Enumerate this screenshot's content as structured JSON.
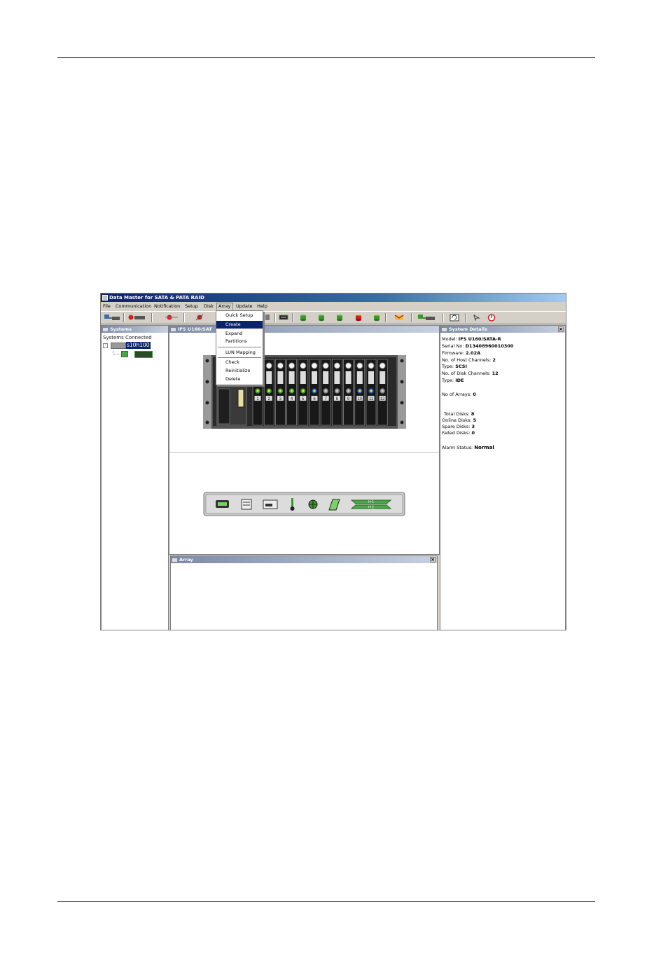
{
  "app": {
    "title": "Data Master for SATA & PATA RAID",
    "menu": [
      "File",
      "Communication",
      "Notification",
      "Setup",
      "Disk",
      "Array",
      "Update",
      "Help"
    ]
  },
  "array_menu": {
    "items": [
      "Quick Setup",
      "Create",
      "Expand",
      "Partitions",
      "LUN Mapping",
      "Check",
      "Reinitialize",
      "Delete"
    ],
    "highlighted": "Create"
  },
  "systems_panel": {
    "title": "Systems",
    "heading": "Systems Connected",
    "host": "s10h100"
  },
  "enclosure_panel": {
    "title": "IFS U160/SAT",
    "slots": [
      "1",
      "2",
      "3",
      "4",
      "5",
      "6",
      "7",
      "8",
      "9",
      "10",
      "11",
      "12"
    ],
    "ctrl_labels": [
      "H 1",
      "H 2"
    ]
  },
  "array_panel": {
    "title": "Array"
  },
  "details_panel": {
    "title": "System Details",
    "model_label": "Model:",
    "model": "IFS U160/SATA-R",
    "serial_label": "Serial No:",
    "serial": "D13408960010300",
    "firmware_label": "Firmware:",
    "firmware": "2.02A",
    "host_ch_label": "No. of Host Channels:",
    "host_ch": "2",
    "host_type_label": "Type:",
    "host_type": "SCSI",
    "disk_ch_label": "No. of Disk Channels:",
    "disk_ch": "12",
    "disk_type_label": "Type:",
    "disk_type": "IDE",
    "arrays_label": "No of Arrays:",
    "arrays": "0",
    "total_label": "Total Disks:",
    "total": "8",
    "online_label": "Online Disks:",
    "online": "5",
    "spare_label": "Spare Disks:",
    "spare": "3",
    "failed_label": "Failed Disks:",
    "failed": "0",
    "alarm_label": "Alarm Status:",
    "alarm": "Normal"
  },
  "colors": {
    "title_bar": "#0a246a",
    "highlight": "#0a246a",
    "disk_online": "#3a9a28",
    "disk_spare": "#2a5ab8",
    "ok_green": "#4aa84a"
  }
}
